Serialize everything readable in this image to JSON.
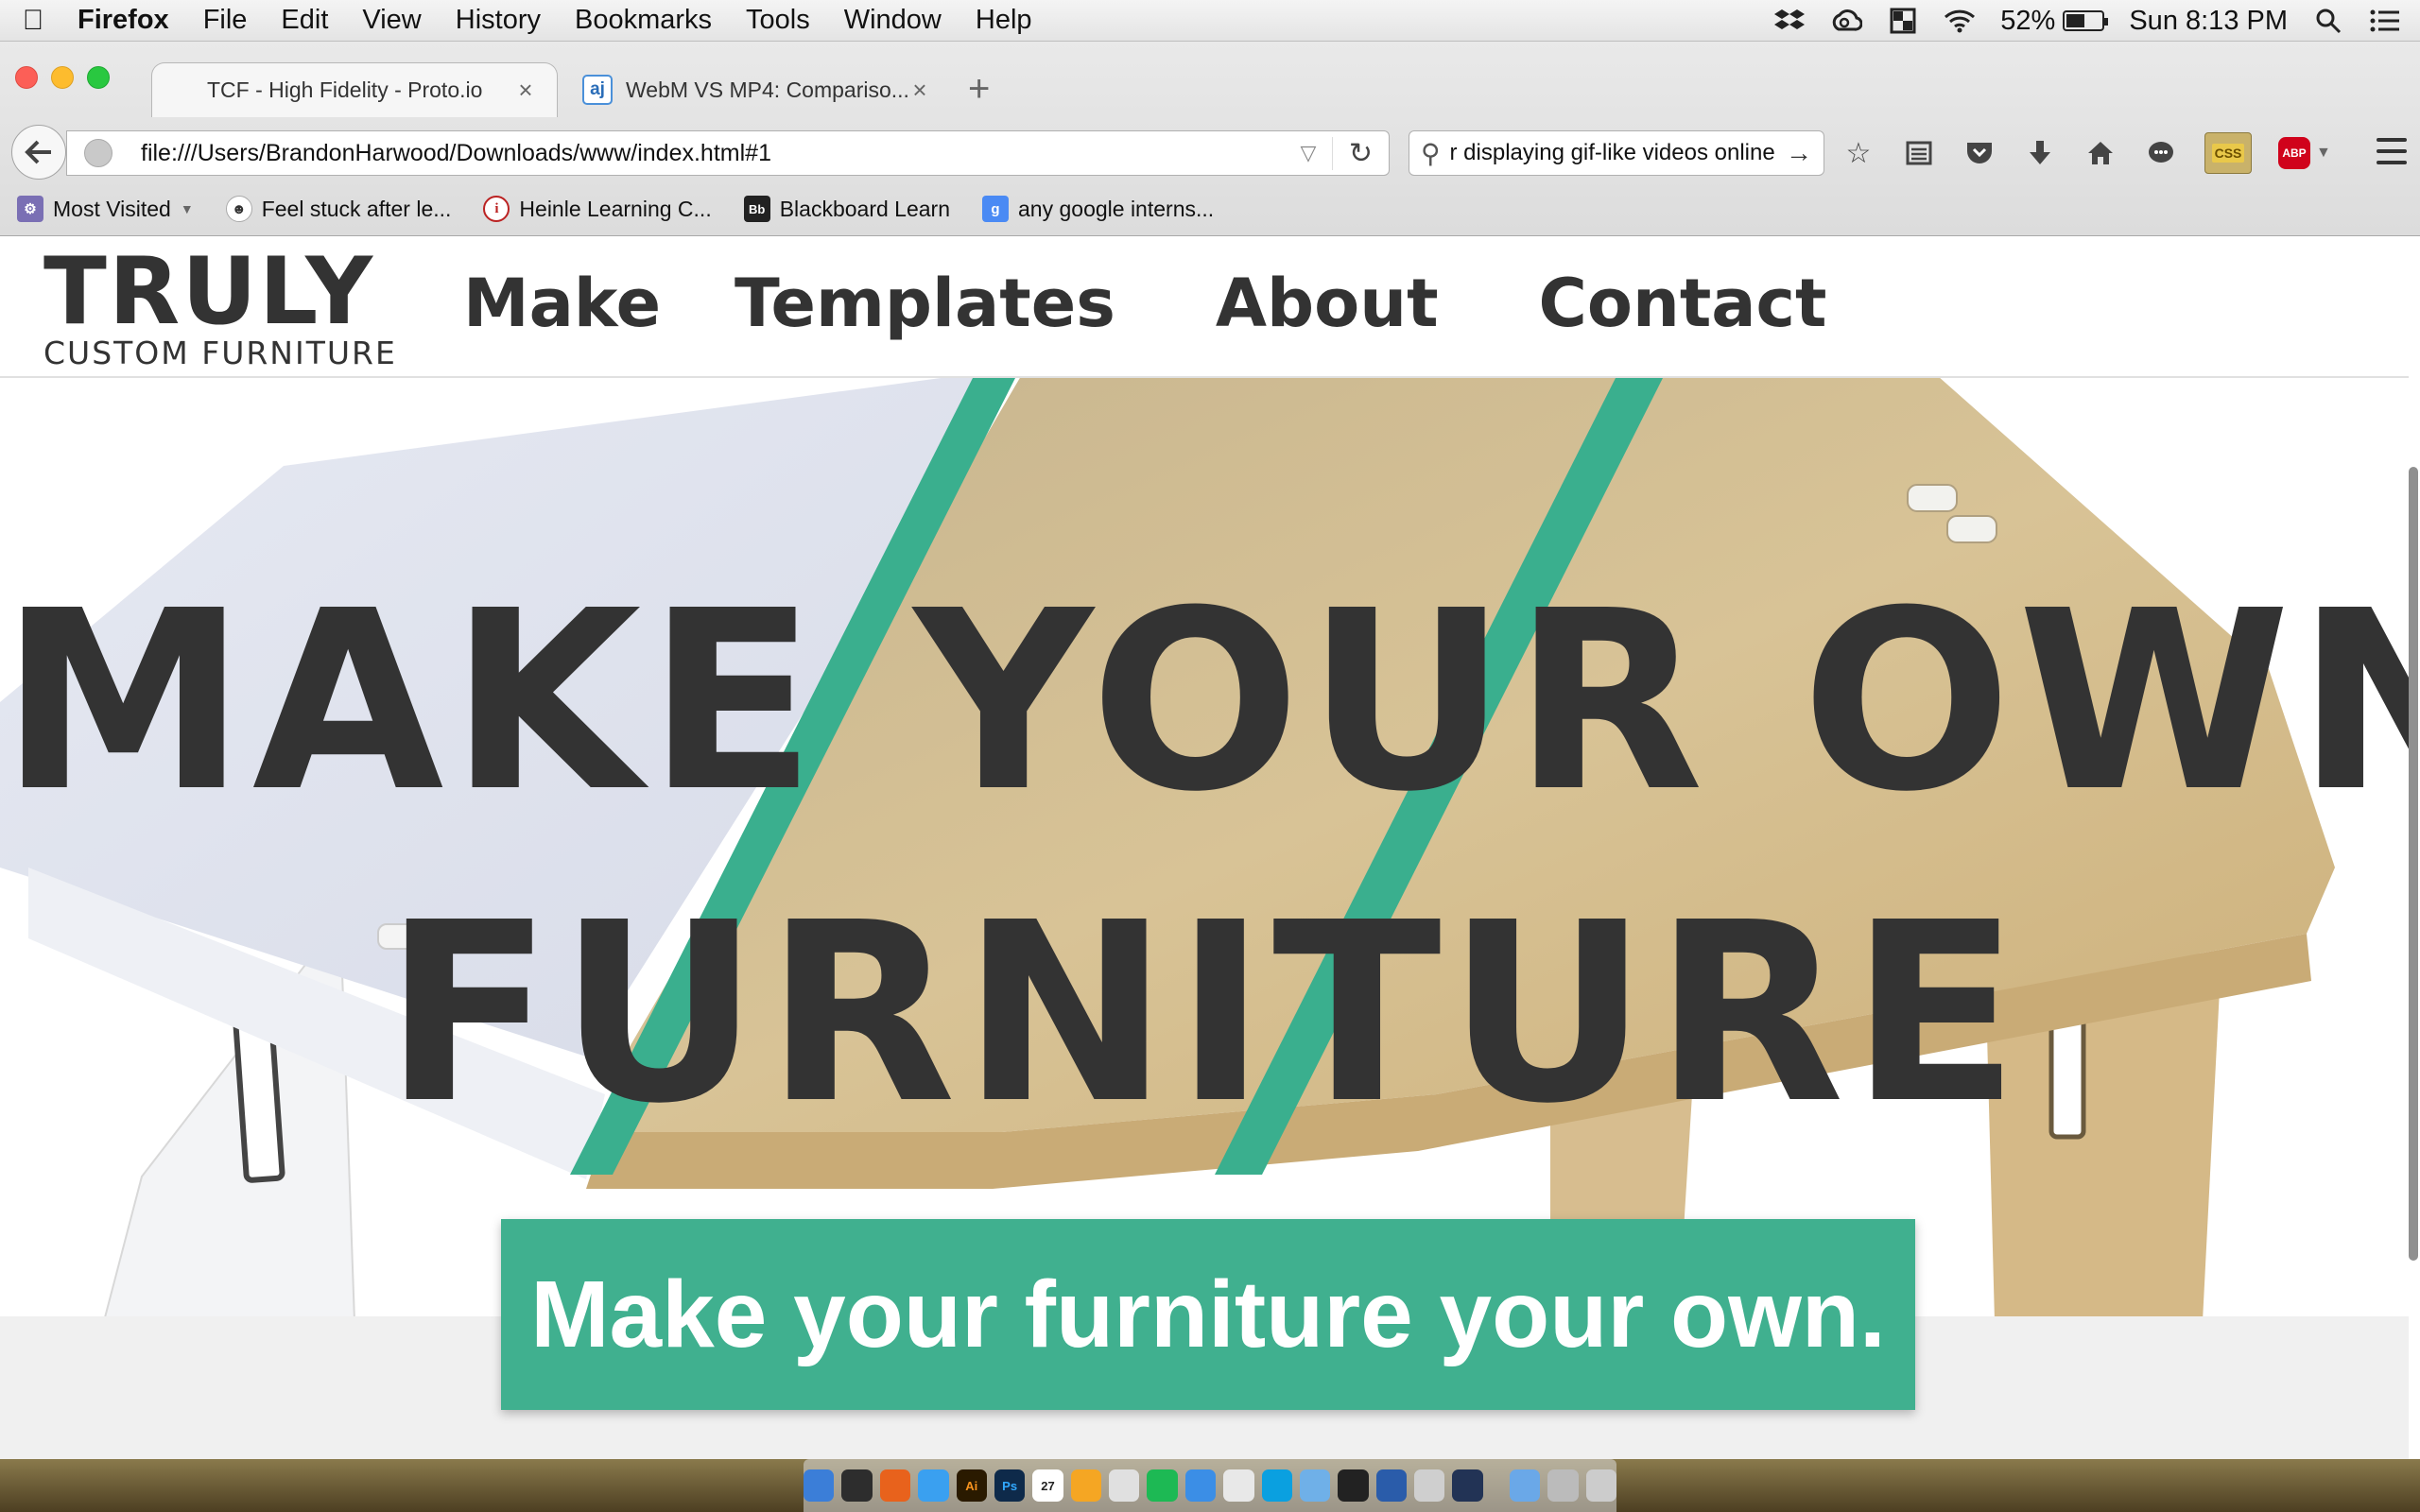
{
  "menubar": {
    "app_name": "Firefox",
    "items": [
      "File",
      "Edit",
      "View",
      "History",
      "Bookmarks",
      "Tools",
      "Window",
      "Help"
    ],
    "battery_percent": "52%",
    "battery_level": 0.52,
    "clock": "Sun 8:13 PM"
  },
  "tabs": [
    {
      "label": "TCF - High Fidelity - Proto.io",
      "active": true
    },
    {
      "label": "WebM VS MP4: Compariso...",
      "active": false,
      "favicon": "aj"
    }
  ],
  "navbar": {
    "url": "file:///Users/BrandonHarwood/Downloads/www/index.html#1",
    "search_value": "r displaying gif-like videos online"
  },
  "bookmarks": [
    {
      "label": "Most Visited",
      "icon": "most-visited-icon"
    },
    {
      "label": "Feel stuck after le...",
      "icon": "reddit-icon"
    },
    {
      "label": "Heinle Learning C...",
      "icon": "info-icon"
    },
    {
      "label": "Blackboard Learn",
      "icon": "blackboard-icon"
    },
    {
      "label": "any google interns...",
      "icon": "google-icon"
    }
  ],
  "toolbar": {
    "css_badge": "CSS",
    "abp_badge": "ABP"
  },
  "site": {
    "logo_main": "TRULY",
    "logo_sub": "CUSTOM FURNITURE",
    "nav": [
      "Make",
      "Templates",
      "About",
      "Contact"
    ],
    "hero_line1": "MAKE YOUR OWN",
    "hero_line2": "FURNITURE",
    "cta": "Make your furniture your own."
  },
  "dock": {
    "calendar_day": "27",
    "items": [
      "finder",
      "dashboard",
      "firefox",
      "messages",
      "illustrator",
      "photoshop",
      "calendar",
      "sketch",
      "chrome-red",
      "spotify",
      "app-store",
      "chrome",
      "skype",
      "mail",
      "steam",
      "word",
      "preview",
      "quicktime",
      "folder",
      "downloads",
      "trash"
    ]
  },
  "colors": {
    "accent_green": "#40b08f",
    "text_dark": "#333333"
  }
}
